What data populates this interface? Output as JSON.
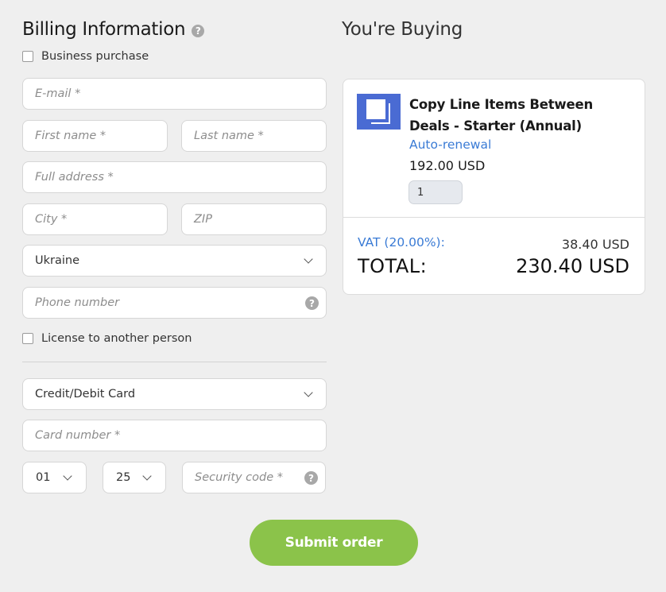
{
  "billing": {
    "title": "Billing Information",
    "help_icon": "?",
    "business_purchase_label": "Business purchase",
    "email_placeholder": "E-mail *",
    "first_name_placeholder": "First name *",
    "last_name_placeholder": "Last name *",
    "address_placeholder": "Full address *",
    "city_placeholder": "City *",
    "zip_placeholder": "ZIP",
    "country_value": "Ukraine",
    "phone_placeholder": "Phone number",
    "license_label": "License to another person",
    "payment_method_value": "Credit/Debit Card",
    "card_number_placeholder": "Card number *",
    "exp_month_value": "01",
    "exp_year_value": "25",
    "security_code_placeholder": "Security code *",
    "submit_label": "Submit order"
  },
  "buying": {
    "title": "You're Buying",
    "product_name": "Copy Line Items Between Deals - Starter (Annual)",
    "auto_renewal_label": "Auto-renewal",
    "unit_price": "192.00 USD",
    "quantity": "1",
    "vat_label": "VAT (20.00%):",
    "vat_value": "38.40 USD",
    "total_label": "TOTAL:",
    "total_value": "230.40 USD"
  },
  "colors": {
    "accent_blue": "#3a7bd5",
    "product_icon": "#4a6bd3",
    "submit_green": "#8bc34a",
    "background": "#efefef"
  },
  "icons": {
    "help": "question-circle-icon",
    "chevron": "chevron-down-icon",
    "product": "copy-squares-icon"
  }
}
